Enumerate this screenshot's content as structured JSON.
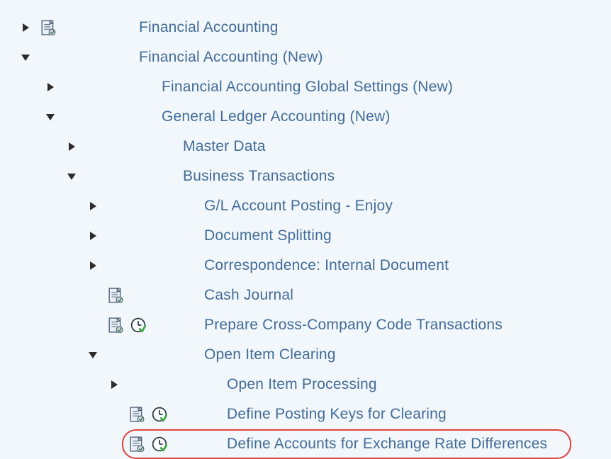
{
  "tree": {
    "financial_accounting": "Financial Accounting",
    "financial_accounting_new": "Financial Accounting (New)",
    "fa_global_settings": "Financial Accounting Global Settings (New)",
    "gl_accounting": "General Ledger Accounting (New)",
    "master_data": "Master Data",
    "business_transactions": "Business Transactions",
    "gl_account_posting": "G/L Account Posting - Enjoy",
    "document_splitting": "Document Splitting",
    "correspondence": "Correspondence: Internal Document",
    "cash_journal": "Cash Journal",
    "prepare_cross_company": "Prepare Cross-Company Code Transactions",
    "open_item_clearing": "Open Item Clearing",
    "open_item_processing": "Open Item Processing",
    "define_posting_keys": "Define Posting Keys for Clearing",
    "define_accounts_exchange": "Define Accounts for Exchange Rate Differences"
  },
  "indents": {
    "l0": 20,
    "l1": 55,
    "l2": 85,
    "l3": 115,
    "l4": 145
  },
  "label_offsets": {
    "l0": 190,
    "l1": 222,
    "l2": 252,
    "l3": 282,
    "l4": 314
  }
}
